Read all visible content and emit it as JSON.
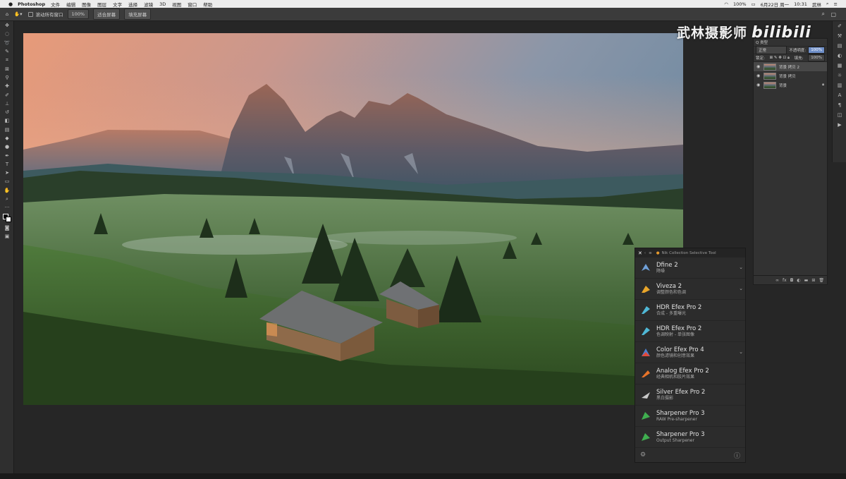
{
  "menubar": {
    "app": "Photoshop",
    "items": [
      "文件",
      "编辑",
      "图像",
      "图层",
      "文字",
      "选择",
      "滤镜",
      "3D",
      "视图",
      "窗口",
      "帮助"
    ],
    "battery": "100%",
    "date": "6月22日 周一",
    "time": "10:31",
    "user": "武林"
  },
  "options_bar": {
    "scroll_all": "滚动所有窗口",
    "zoom": "100%",
    "fit_screen": "适合屏幕",
    "fill_screen": "填充屏幕"
  },
  "watermark": {
    "text": "武林摄影师",
    "logo": "bilibili"
  },
  "layers_panel": {
    "kind": "Q 类型",
    "blend_mode": "正常",
    "opacity_label": "不透明度:",
    "opacity_value": "100%",
    "lock_label": "锁定:",
    "fill_label": "填充:",
    "fill_value": "100%",
    "layers": [
      {
        "name": "背景 拷贝 2",
        "active": true
      },
      {
        "name": "背景 拷贝",
        "active": false
      },
      {
        "name": "背景",
        "active": false
      }
    ]
  },
  "nik_panel": {
    "title": "Nik Collection Selective Tool",
    "items": [
      {
        "name": "Dfine 2",
        "subtitle": "降噪",
        "color": "#6fa0d8",
        "has_menu": true
      },
      {
        "name": "Viveza 2",
        "subtitle": "调整颜色和色调",
        "color": "#e8a52a",
        "has_menu": true
      },
      {
        "name": "HDR Efex Pro 2",
        "subtitle": "合成 - 多重曝光",
        "color": "#4fb8d6",
        "has_menu": false
      },
      {
        "name": "HDR Efex Pro 2",
        "subtitle": "色调映射 - 单张图像",
        "color": "#4fb8d6",
        "has_menu": false
      },
      {
        "name": "Color Efex Pro 4",
        "subtitle": "颜色滤镜和创意效果",
        "color": "#4b7fd1",
        "has_menu": true
      },
      {
        "name": "Analog Efex Pro 2",
        "subtitle": "经典相机和胶片效果",
        "color": "#e8742a",
        "has_menu": false
      },
      {
        "name": "Silver Efex Pro 2",
        "subtitle": "黑白摄影",
        "color": "#c9c9c9",
        "has_menu": false
      },
      {
        "name": "Sharpener Pro 3",
        "subtitle": "RAW Pre-sharpener",
        "color": "#3fae4f",
        "has_menu": false
      },
      {
        "name": "Sharpener Pro 3",
        "subtitle": "Output Sharpener",
        "color": "#3fae4f",
        "has_menu": false
      }
    ]
  }
}
